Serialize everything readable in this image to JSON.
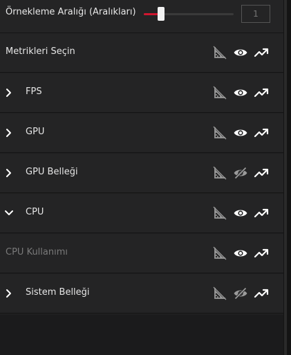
{
  "header": {
    "sampling_label": "Örnekleme Aralığı (Aralıkları)",
    "slider_fraction": 0.19,
    "value": "1"
  },
  "colors": {
    "accent": "#d0162f",
    "background": "#242425",
    "text": "#e6e6e6",
    "text_dim": "#7a7a7a",
    "icon": "#9a9a9a",
    "icon_active": "#ffffff"
  },
  "rows": [
    {
      "label": "Metrikleri Seçin",
      "chevron": "none",
      "dim": false,
      "eye": "visible"
    },
    {
      "label": "FPS",
      "chevron": "right",
      "dim": false,
      "eye": "visible"
    },
    {
      "label": "GPU",
      "chevron": "right",
      "dim": false,
      "eye": "visible"
    },
    {
      "label": "GPU Belleği",
      "chevron": "right",
      "dim": false,
      "eye": "hidden"
    },
    {
      "label": "CPU",
      "chevron": "down",
      "dim": false,
      "eye": "visible"
    },
    {
      "label": "CPU Kullanımı",
      "chevron": "none",
      "dim": true,
      "eye": "visible"
    },
    {
      "label": "Sistem Belleği",
      "chevron": "right",
      "dim": false,
      "eye": "hidden"
    }
  ],
  "icons": {
    "ruler": "ruler-icon",
    "eye": "eye-icon",
    "eye_off": "eye-off-icon",
    "trend": "trend-up-icon",
    "chevron_right": "chevron-right-icon",
    "chevron_down": "chevron-down-icon"
  }
}
